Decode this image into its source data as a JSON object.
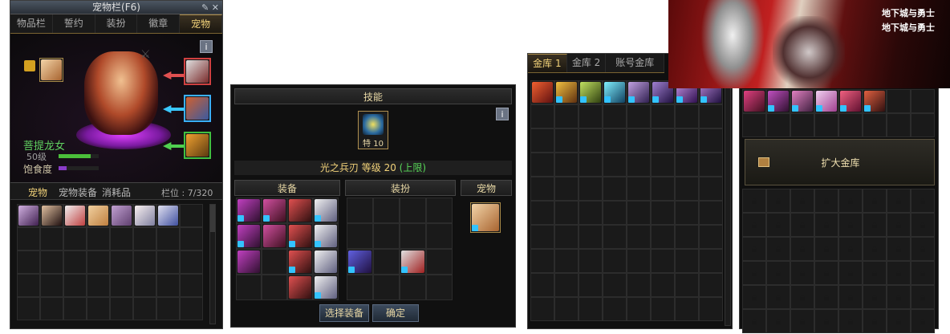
{
  "pet_window": {
    "title": "宠物栏(F6)",
    "tabs": [
      "物品栏",
      "誓约",
      "装扮",
      "徽章",
      "宠物"
    ],
    "active_tab": 4,
    "info_label": "i",
    "pet_name": "菩提龙女",
    "pet_level": "50级",
    "satiety_label": "饱食度",
    "level_bar_fraction": 0.8,
    "satiety_bar_fraction": 0.2,
    "sub_tabs": [
      "宠物",
      "宠物装备",
      "消耗品"
    ],
    "slots_label": "栏位 : 7/320"
  },
  "skill_window": {
    "title": "技能",
    "info_label": "i",
    "skill_badge": "特 10",
    "skill_desc": "光之兵刃 等级 20",
    "skill_limit": "(上限)",
    "sections": [
      "装备",
      "装扮",
      "宠物"
    ],
    "buttons": {
      "select": "选择装备",
      "confirm": "确定"
    }
  },
  "vault_window": {
    "tabs": [
      "金库 1",
      "金库 2",
      "账号金库"
    ],
    "active_tab": 0
  },
  "expand_window": {
    "expand_label": "扩大金库"
  },
  "banner": {
    "logo_text": [
      "地下城与勇士",
      "地下城与勇士"
    ]
  },
  "colors": {
    "gold": "#f3d37a",
    "panel": "#121212",
    "green_bar": "#4bbf3a",
    "purple_bar": "#8a3cc8",
    "lock_blue": "#33c3ff"
  }
}
